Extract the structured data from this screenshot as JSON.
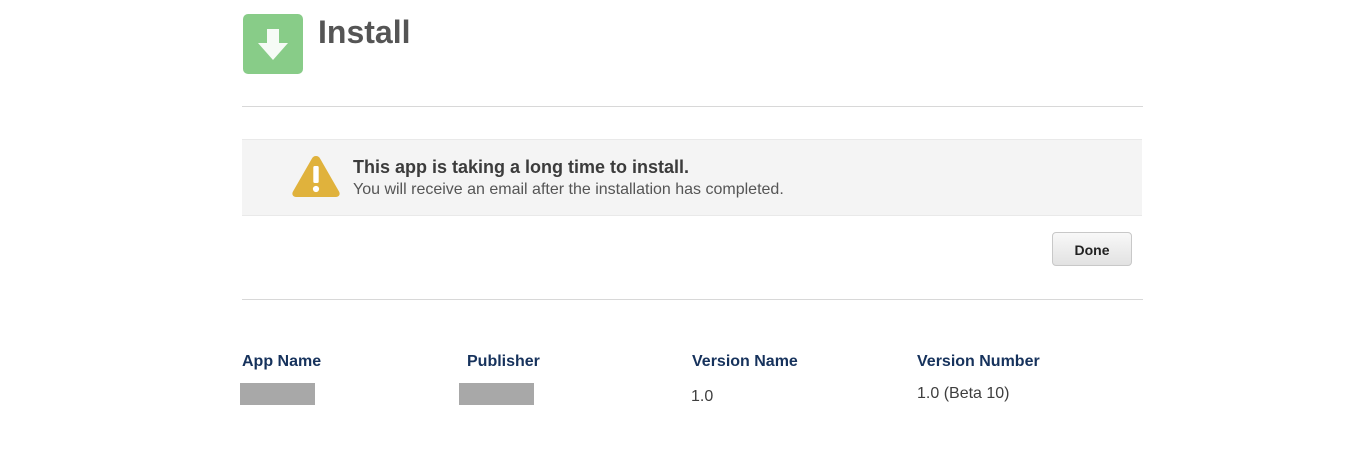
{
  "header": {
    "title": "Install",
    "icon": "download-arrow-icon",
    "icon_color": "#88cc88"
  },
  "notice": {
    "icon": "warning-icon",
    "icon_color": "#e0b23c",
    "title": "This app is taking a long time to install.",
    "message": "You will receive an email after the installation has completed."
  },
  "actions": {
    "done_label": "Done"
  },
  "details": {
    "columns": [
      {
        "label": "App Name",
        "value": "",
        "redacted": true
      },
      {
        "label": "Publisher",
        "value": "",
        "redacted": true
      },
      {
        "label": "Version Name",
        "value": "1.0",
        "redacted": false
      },
      {
        "label": "Version Number",
        "value": "1.0 (Beta 10)",
        "redacted": false
      }
    ]
  }
}
